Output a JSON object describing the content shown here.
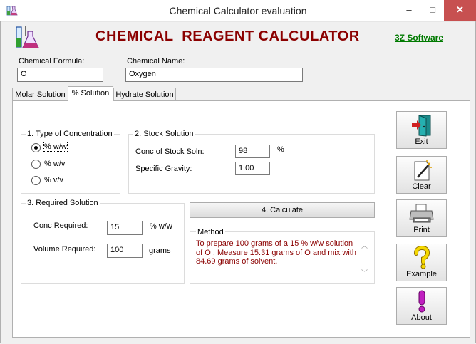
{
  "window": {
    "title": "Chemical Calculator evaluation",
    "minimize": "–",
    "maximize": "□",
    "close": "✕"
  },
  "header": {
    "title": "CHEMICAL  REAGENT CALCULATOR",
    "brand": "3Z Software"
  },
  "chemical": {
    "formula_label": "Chemical Formula:",
    "formula_value": "O",
    "name_label": "Chemical Name:",
    "name_value": "Oxygen"
  },
  "tabs": [
    {
      "label": "Molar Solution",
      "active": false
    },
    {
      "label": "% Solution",
      "active": true
    },
    {
      "label": "Hydrate Solution",
      "active": false
    }
  ],
  "concentration": {
    "title": "1. Type of Concentration",
    "options": [
      {
        "label": "% w/w",
        "selected": true
      },
      {
        "label": "% w/v",
        "selected": false
      },
      {
        "label": "% v/v",
        "selected": false
      }
    ]
  },
  "stock": {
    "title": "2. Stock Solution",
    "conc_label": "Conc of Stock Soln:",
    "conc_value": "98",
    "conc_unit": "%",
    "gravity_label": "Specific Gravity:",
    "gravity_value": "1.00"
  },
  "required": {
    "title": "3. Required Solution",
    "conc_label": "Conc Required:",
    "conc_value": "15",
    "conc_unit": "% w/w",
    "volume_label": "Volume Required:",
    "volume_value": "100",
    "volume_unit": "grams"
  },
  "calculate_label": "4. Calculate",
  "method": {
    "title": "Method",
    "text": "To prepare 100 grams of a 15 % w/w solution of O , Measure 15.31 grams of O and mix with 84.69 grams of solvent."
  },
  "side_buttons": [
    {
      "label": "Exit",
      "icon": "exit-door-icon"
    },
    {
      "label": "Clear",
      "icon": "clear-wand-icon"
    },
    {
      "label": "Print",
      "icon": "printer-icon"
    },
    {
      "label": "Example",
      "icon": "question-mark-icon"
    },
    {
      "label": "About",
      "icon": "exclamation-icon"
    }
  ],
  "colors": {
    "title": "#8b0000",
    "brand": "#007a00",
    "method_text": "#8b0000",
    "close_button": "#c75050"
  }
}
